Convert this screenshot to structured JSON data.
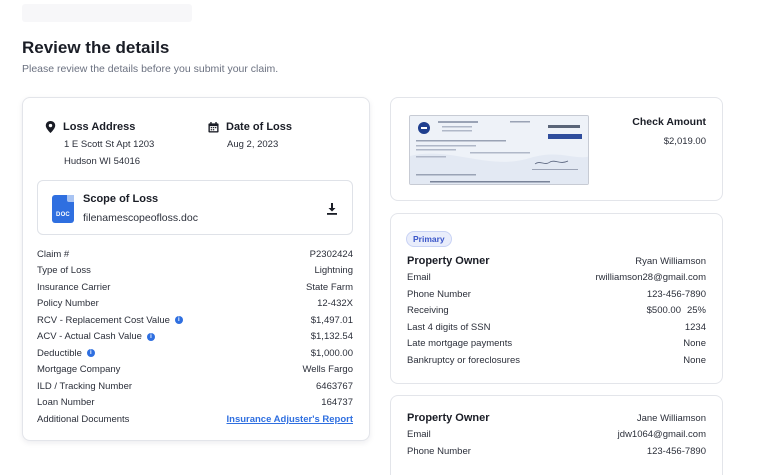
{
  "page": {
    "title": "Review the details",
    "subtitle": "Please review the details before you submit your claim."
  },
  "loss_address": {
    "label": "Loss Address",
    "line1": "1 E Scott St Apt 1203",
    "line2": "Hudson WI 54016"
  },
  "date_of_loss": {
    "label": "Date of Loss",
    "value": "Aug 2, 2023"
  },
  "scope_of_loss": {
    "title": "Scope of Loss",
    "filename": "filenamescopeofloss.doc",
    "doc_badge": "DOC"
  },
  "claim_details": [
    {
      "label": "Claim #",
      "value": "P2302424",
      "info": false
    },
    {
      "label": "Type of Loss",
      "value": "Lightning",
      "info": false
    },
    {
      "label": "Insurance Carrier",
      "value": "State Farm",
      "info": false
    },
    {
      "label": "Policy Number",
      "value": "12-432X",
      "info": false
    },
    {
      "label": "RCV - Replacement Cost Value",
      "value": "$1,497.01",
      "info": true
    },
    {
      "label": "ACV - Actual Cash Value",
      "value": "$1,132.54",
      "info": true
    },
    {
      "label": "Deductible",
      "value": "$1,000.00",
      "info": true
    },
    {
      "label": "Mortgage Company",
      "value": "Wells Fargo",
      "info": false
    },
    {
      "label": "ILD / Tracking Number",
      "value": "6463767",
      "info": false
    },
    {
      "label": "Loan Number",
      "value": "164737",
      "info": false
    }
  ],
  "additional_documents": {
    "label": "Additional Documents",
    "link": "Insurance Adjuster's Report"
  },
  "check": {
    "label": "Check Amount",
    "value": "$2,019.00"
  },
  "owners": [
    {
      "badge": "Primary",
      "heading": "Property Owner",
      "name": "Ryan Williamson",
      "email_label": "Email",
      "email": "rwilliamson28@gmail.com",
      "phone_label": "Phone Number",
      "phone": "123-456-7890",
      "receiving_label": "Receiving",
      "receiving_amount": "$500.00",
      "receiving_percent": "25%",
      "ssn_label": "Last 4 digits of SSN",
      "ssn": "1234",
      "late_label": "Late mortgage payments",
      "late": "None",
      "bankruptcy_label": "Bankruptcy or foreclosures",
      "bankruptcy": "None"
    },
    {
      "heading": "Property Owner",
      "name": "Jane Williamson",
      "email_label": "Email",
      "email": "jdw1064@gmail.com",
      "phone_label": "Phone Number",
      "phone": "123-456-7890"
    }
  ],
  "colors": {
    "accent": "#2f6fe0",
    "badge_bg": "#e9edfb",
    "text": "#1f2430"
  }
}
